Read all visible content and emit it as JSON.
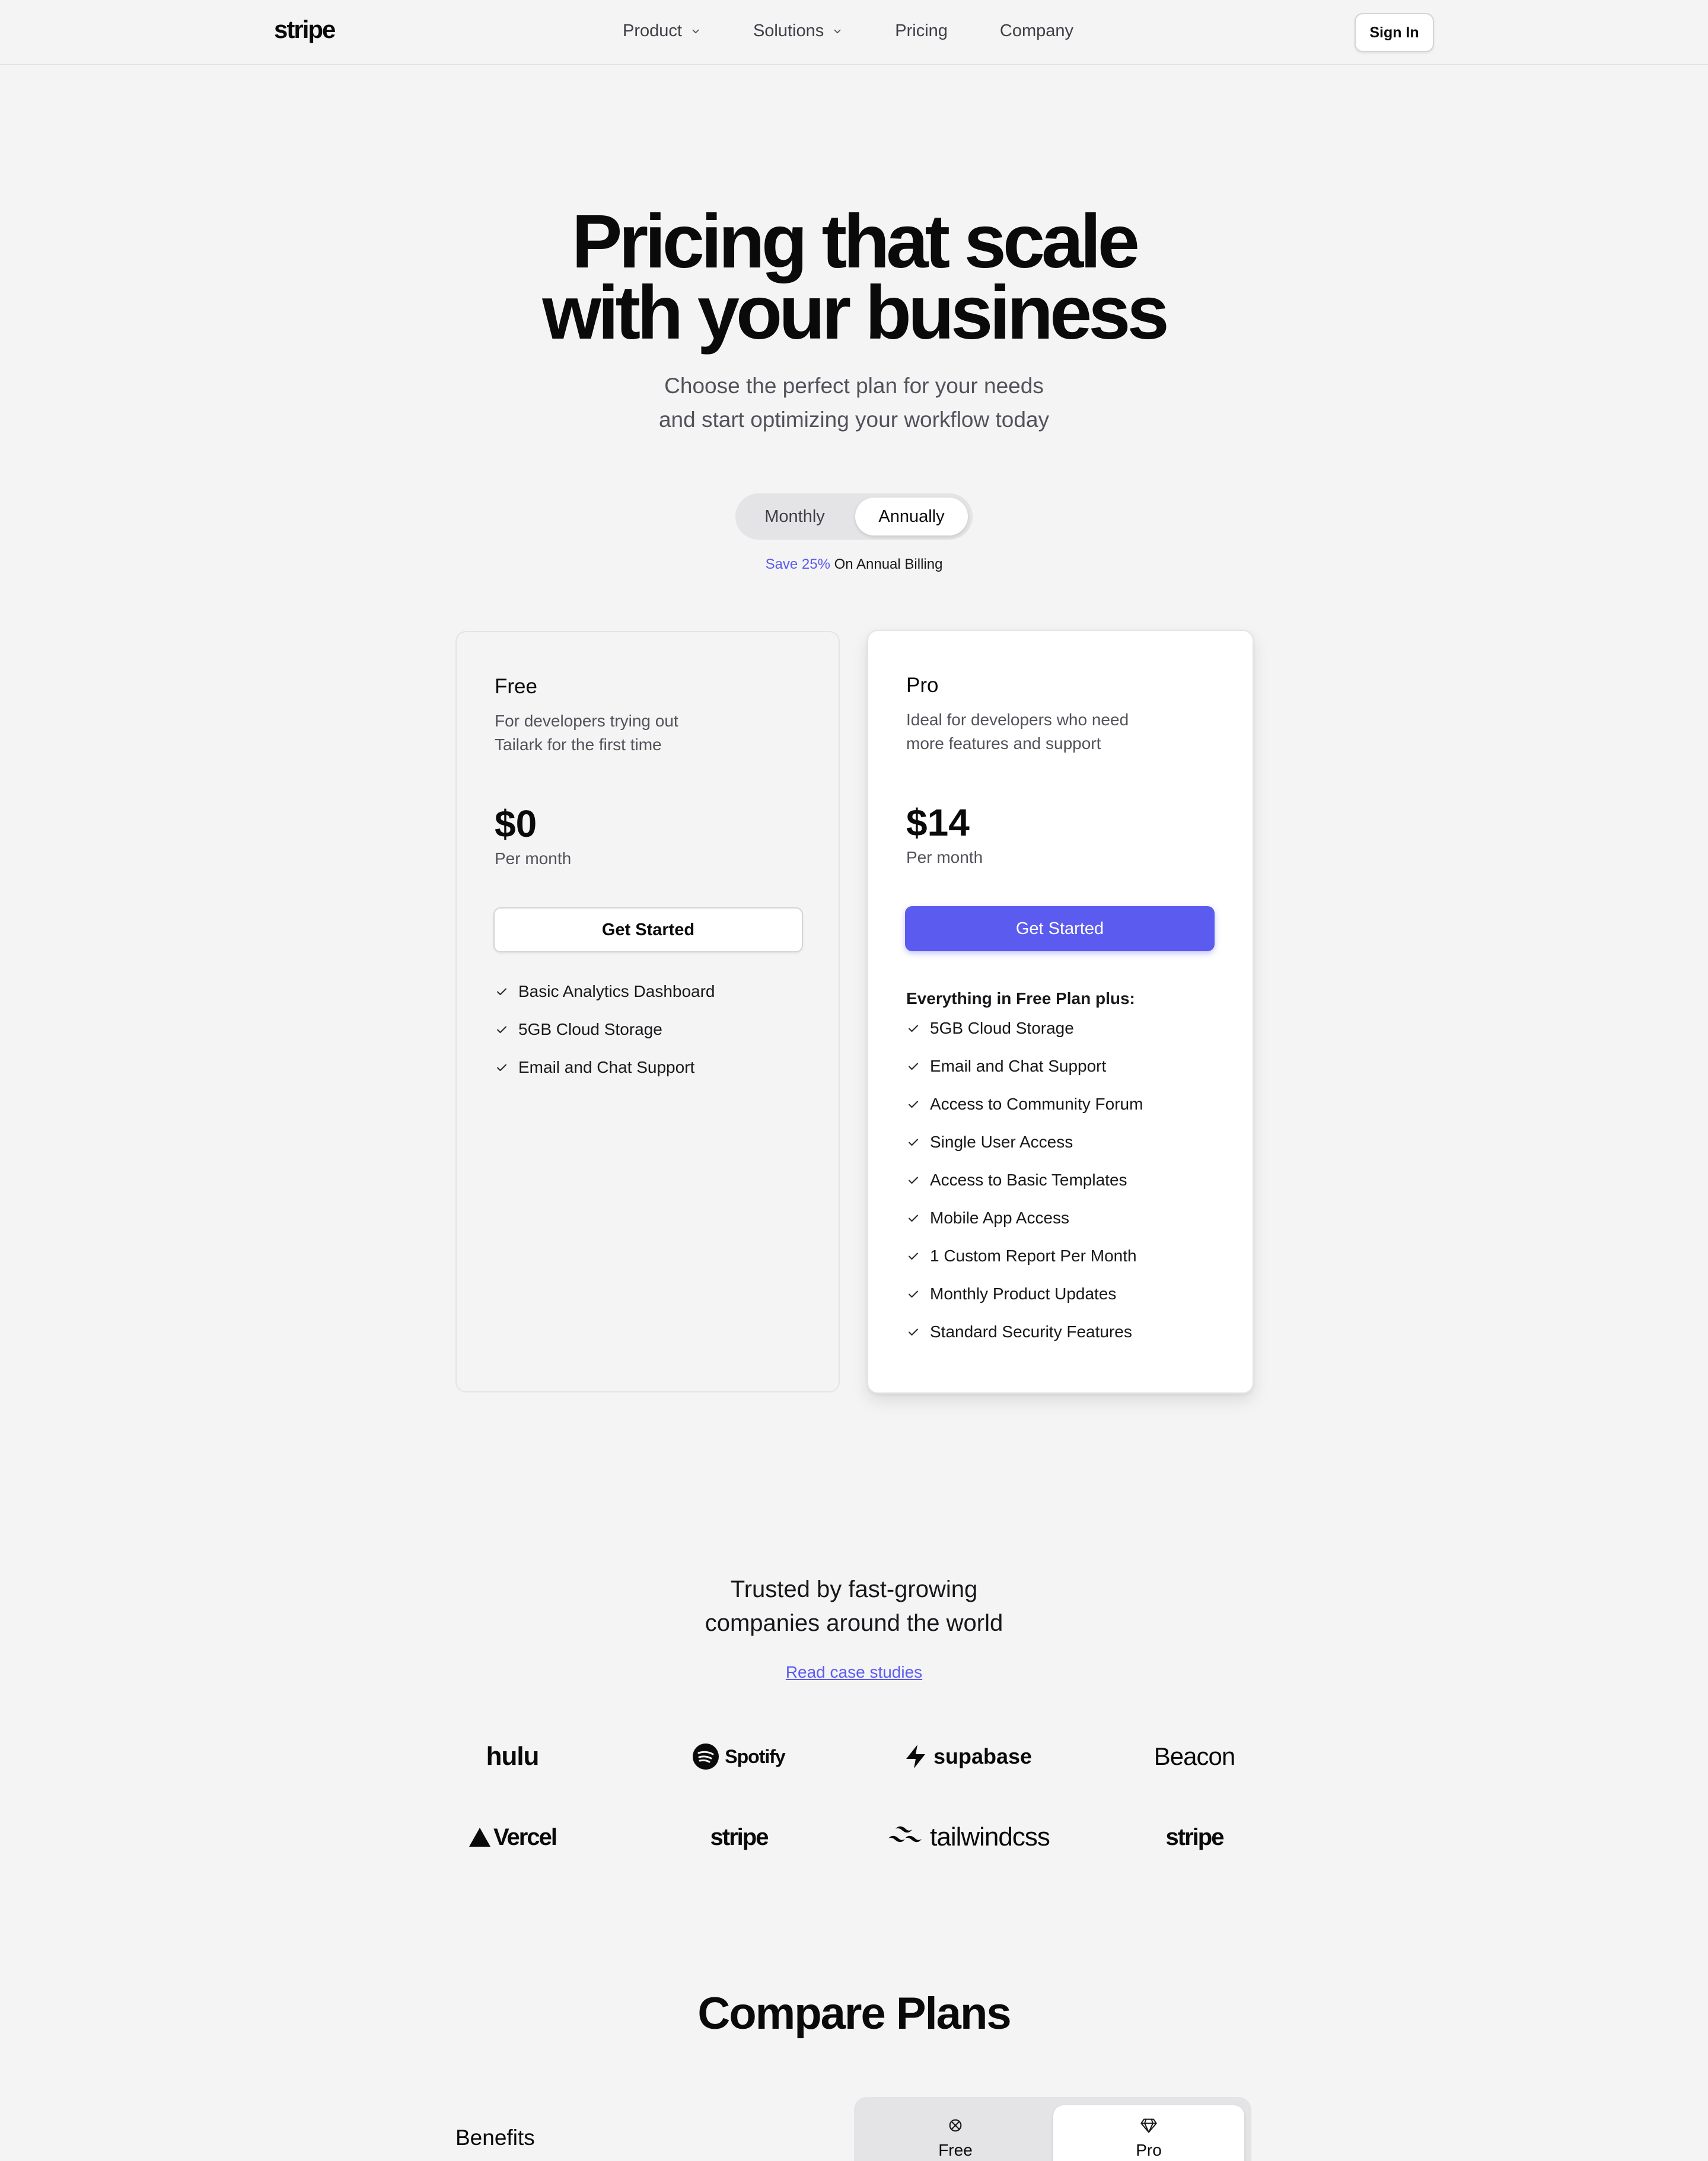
{
  "nav": {
    "logo": "stripe",
    "links": [
      {
        "label": "Product",
        "dropdown": true
      },
      {
        "label": "Solutions",
        "dropdown": true
      },
      {
        "label": "Pricing",
        "dropdown": false
      },
      {
        "label": "Company",
        "dropdown": false
      }
    ],
    "signin_label": "Sign In"
  },
  "hero": {
    "title_line1": "Pricing that scale",
    "title_line2": "with your business",
    "subtitle_line1": "Choose the perfect plan for your needs",
    "subtitle_line2": "and start optimizing your workflow today"
  },
  "billing": {
    "options": [
      "Monthly",
      "Annually"
    ],
    "selected": "Annually",
    "save_accent": "Save 25%",
    "save_rest": "On Annual Billing"
  },
  "plans": [
    {
      "name": "Free",
      "desc_line1": "For developers trying out",
      "desc_line2": "Tailark for the first time",
      "price": "$0",
      "period": "Per month",
      "cta": "Get Started",
      "features_heading": "",
      "features": [
        "Basic Analytics Dashboard",
        "5GB Cloud Storage",
        "Email and Chat Support"
      ]
    },
    {
      "name": "Pro",
      "desc_line1": "Ideal for developers who need",
      "desc_line2": "more features and support",
      "price": "$14",
      "period": "Per month",
      "cta": "Get Started",
      "features_heading": "Everything in Free Plan plus:",
      "features": [
        "5GB Cloud Storage",
        "Email and Chat Support",
        "Access to Community Forum",
        "Single User Access",
        "Access to Basic Templates",
        "Mobile App Access",
        "1 Custom Report Per Month",
        "Monthly Product Updates",
        "Standard Security Features"
      ]
    }
  ],
  "trusted": {
    "title_line1": "Trusted by fast-growing",
    "title_line2": "companies around the world",
    "link": "Read case studies",
    "logos": [
      "hulu",
      "Spotify",
      "supabase",
      "Beacon",
      "Vercel",
      "stripe",
      "tailwindcss",
      "stripe"
    ]
  },
  "compare": {
    "title": "Compare Plans",
    "benefits_label": "Benefits",
    "tabs": [
      {
        "label": "Free",
        "icon": "broken-circle-icon"
      },
      {
        "label": "Pro",
        "icon": "gem-icon"
      }
    ]
  },
  "colors": {
    "accent": "#5b5bf0",
    "background": "#f4f4f5"
  }
}
